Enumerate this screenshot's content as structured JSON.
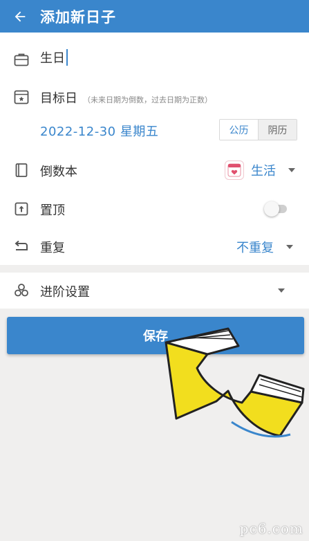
{
  "header": {
    "title": "添加新日子",
    "back_icon": "arrow-left-icon"
  },
  "form": {
    "name": {
      "icon": "briefcase-icon",
      "value": "生日"
    },
    "target_date": {
      "icon": "calendar-icon",
      "label": "目标日",
      "hint": "（未来日期为倒数，过去日期为正数）",
      "value": "2022-12-30 星期五",
      "calendar_options": [
        "公历",
        "阴历"
      ],
      "selected_calendar": "公历"
    },
    "book": {
      "icon": "book-icon",
      "label": "倒数本",
      "value": "生活",
      "value_icon": "heart-calendar-icon"
    },
    "pin": {
      "icon": "pin-top-icon",
      "label": "置顶",
      "enabled": false
    },
    "repeat": {
      "icon": "repeat-icon",
      "label": "重复",
      "value": "不重复"
    },
    "advanced": {
      "icon": "cubes-icon",
      "label": "进阶设置"
    }
  },
  "actions": {
    "save_label": "保存"
  },
  "watermark": {
    "text": "pc6.com"
  },
  "colors": {
    "accent": "#3a86cc",
    "background": "#f0efee",
    "pointer": "#f2de1e"
  }
}
